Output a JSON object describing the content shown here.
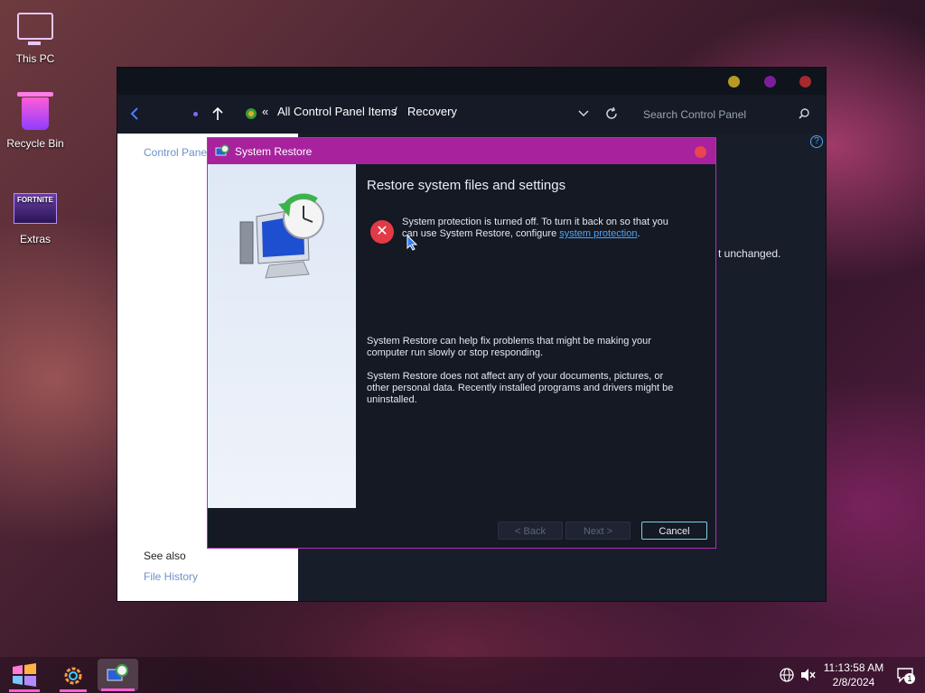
{
  "desktop": {
    "icons": [
      {
        "label": "This PC",
        "icon": "computer-icon"
      },
      {
        "label": "Recycle Bin",
        "icon": "recycle-bin-icon"
      },
      {
        "label": "Extras",
        "icon": "fortnite-icon"
      }
    ]
  },
  "explorer": {
    "breadcrumb_chevron": "«",
    "breadcrumb": [
      "All Control Panel Items",
      "Recovery"
    ],
    "breadcrumb_separator": "/",
    "search_placeholder": "Search Control Panel",
    "left_pane": {
      "control_panel_link": "Control Panel",
      "see_also": "See also",
      "file_history": "File History"
    },
    "help_symbol": "?",
    "partial_text": "t unchanged."
  },
  "dialog": {
    "title": "System Restore",
    "heading": "Restore system files and settings",
    "error_message_part1": "System protection is turned off. To turn it back on so that you can use System Restore, configure ",
    "error_link": "system protection",
    "error_message_part2": ".",
    "paragraph1": "System Restore can help fix problems that might be making your computer run slowly or stop responding.",
    "paragraph2": "System Restore does not affect any of your documents, pictures, or other personal data. Recently installed programs and drivers might be uninstalled.",
    "buttons": {
      "back": "< Back",
      "next": "Next >",
      "cancel": "Cancel"
    }
  },
  "taskbar": {
    "time": "11:13:58 AM",
    "date": "2/8/2024",
    "notification_count": "1"
  },
  "colors": {
    "dialog_title_bg": "#a8229e",
    "dialog_border": "#b42fb5",
    "explorer_bg": "#171d29",
    "link": "#4aa6ff",
    "error": "#e23a46"
  }
}
